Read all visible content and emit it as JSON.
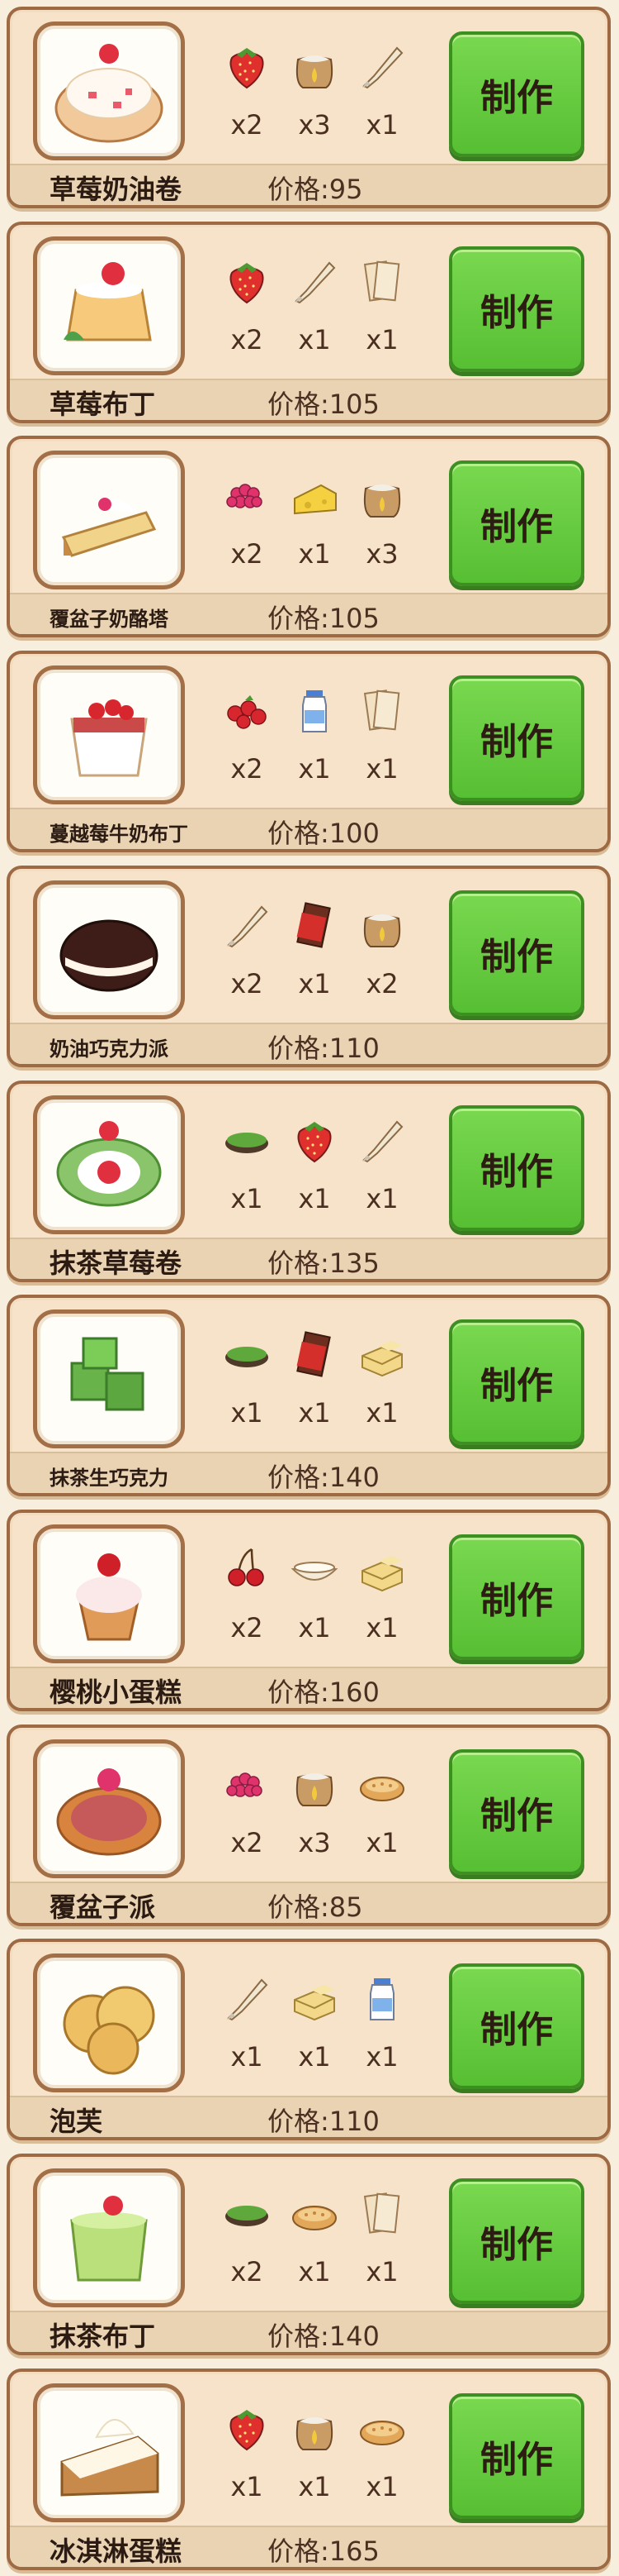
{
  "make_label": "制作",
  "price_prefix": "价格:",
  "recipes": [
    {
      "name": "草莓奶油卷",
      "price": "95",
      "dish_icon": "strawberry-cream-roll-icon",
      "ingredients": [
        {
          "icon": "strawberry-icon",
          "qty": "x2"
        },
        {
          "icon": "flour-sack-icon",
          "qty": "x3"
        },
        {
          "icon": "cream-piping-bag-icon",
          "qty": "x1"
        }
      ]
    },
    {
      "name": "草莓布丁",
      "price": "105",
      "dish_icon": "strawberry-pudding-icon",
      "ingredients": [
        {
          "icon": "strawberry-icon",
          "qty": "x2"
        },
        {
          "icon": "cream-piping-bag-icon",
          "qty": "x1"
        },
        {
          "icon": "pastry-sheet-icon",
          "qty": "x1"
        }
      ]
    },
    {
      "name": "覆盆子奶酪塔",
      "price": "105",
      "dish_icon": "raspberry-cheesecake-icon",
      "ingredients": [
        {
          "icon": "raspberry-icon",
          "qty": "x2"
        },
        {
          "icon": "cheese-icon",
          "qty": "x1"
        },
        {
          "icon": "flour-sack-icon",
          "qty": "x3"
        }
      ]
    },
    {
      "name": "蔓越莓牛奶布丁",
      "price": "100",
      "dish_icon": "cranberry-milk-pudding-icon",
      "ingredients": [
        {
          "icon": "cranberry-icon",
          "qty": "x2"
        },
        {
          "icon": "milk-bottle-icon",
          "qty": "x1"
        },
        {
          "icon": "pastry-sheet-icon",
          "qty": "x1"
        }
      ]
    },
    {
      "name": "奶油巧克力派",
      "price": "110",
      "dish_icon": "cream-chocolate-pie-icon",
      "ingredients": [
        {
          "icon": "cream-piping-bag-icon",
          "qty": "x2"
        },
        {
          "icon": "chocolate-bar-icon",
          "qty": "x1"
        },
        {
          "icon": "flour-sack-icon",
          "qty": "x2"
        }
      ]
    },
    {
      "name": "抹茶草莓卷",
      "price": "135",
      "dish_icon": "matcha-strawberry-roll-icon",
      "ingredients": [
        {
          "icon": "matcha-powder-icon",
          "qty": "x1"
        },
        {
          "icon": "strawberry-icon",
          "qty": "x1"
        },
        {
          "icon": "cream-piping-bag-icon",
          "qty": "x1"
        }
      ]
    },
    {
      "name": "抹茶生巧克力",
      "price": "140",
      "dish_icon": "matcha-chocolate-icon",
      "ingredients": [
        {
          "icon": "matcha-powder-icon",
          "qty": "x1"
        },
        {
          "icon": "chocolate-bar-icon",
          "qty": "x1"
        },
        {
          "icon": "butter-icon",
          "qty": "x1"
        }
      ]
    },
    {
      "name": "樱桃小蛋糕",
      "price": "160",
      "dish_icon": "cherry-cupcake-icon",
      "ingredients": [
        {
          "icon": "cherry-icon",
          "qty": "x2"
        },
        {
          "icon": "flour-bowl-icon",
          "qty": "x1"
        },
        {
          "icon": "butter-icon",
          "qty": "x1"
        }
      ]
    },
    {
      "name": "覆盆子派",
      "price": "85",
      "dish_icon": "raspberry-pie-icon",
      "ingredients": [
        {
          "icon": "raspberry-icon",
          "qty": "x2"
        },
        {
          "icon": "flour-sack-icon",
          "qty": "x3"
        },
        {
          "icon": "tart-shell-icon",
          "qty": "x1"
        }
      ]
    },
    {
      "name": "泡芙",
      "price": "110",
      "dish_icon": "cream-puff-icon",
      "ingredients": [
        {
          "icon": "cream-piping-bag-icon",
          "qty": "x1"
        },
        {
          "icon": "butter-icon",
          "qty": "x1"
        },
        {
          "icon": "milk-bottle-icon",
          "qty": "x1"
        }
      ]
    },
    {
      "name": "抹茶布丁",
      "price": "140",
      "dish_icon": "matcha-pudding-icon",
      "ingredients": [
        {
          "icon": "matcha-powder-icon",
          "qty": "x2"
        },
        {
          "icon": "tart-shell-icon",
          "qty": "x1"
        },
        {
          "icon": "pastry-sheet-icon",
          "qty": "x1"
        }
      ]
    },
    {
      "name": "冰淇淋蛋糕",
      "price": "165",
      "dish_icon": "ice-cream-cake-icon",
      "ingredients": [
        {
          "icon": "strawberry-icon",
          "qty": "x1"
        },
        {
          "icon": "flour-sack-icon",
          "qty": "x1"
        },
        {
          "icon": "tart-shell-icon",
          "qty": "x1"
        }
      ]
    }
  ],
  "colors": {
    "make_button": "#5fc638",
    "card_border": "#9d6a44",
    "card_bg": "#f6e3c9"
  }
}
